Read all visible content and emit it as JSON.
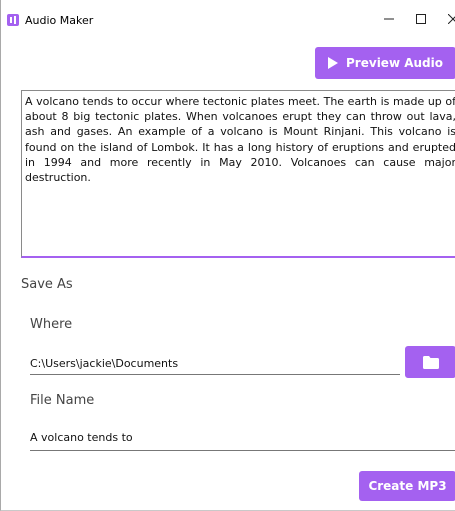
{
  "window": {
    "title": "Audio Maker",
    "accent_color": "#a461f0",
    "icon": "audio-maker-app-icon"
  },
  "toolbar": {
    "preview_label": "Preview Audio",
    "preview_icon": "play-icon"
  },
  "editor": {
    "text": "A volcano tends to occur where tectonic plates meet.  The earth is made up of about 8 big tectonic plates.  When volcanoes erupt they can throw out lava, ash and gases. An example of a volcano is Mount Rinjani.  This volcano is found on the island of Lombok.  It has a long history of eruptions and erupted in 1994 and more recently in May 2010. Volcanoes can cause major destruction."
  },
  "save": {
    "section_label": "Save As",
    "where_label": "Where",
    "where_value": "C:\\Users\\jackie\\Documents",
    "browse_icon": "folder-icon",
    "filename_label": "File Name",
    "filename_value": "A volcano tends to",
    "create_label": "Create MP3"
  }
}
